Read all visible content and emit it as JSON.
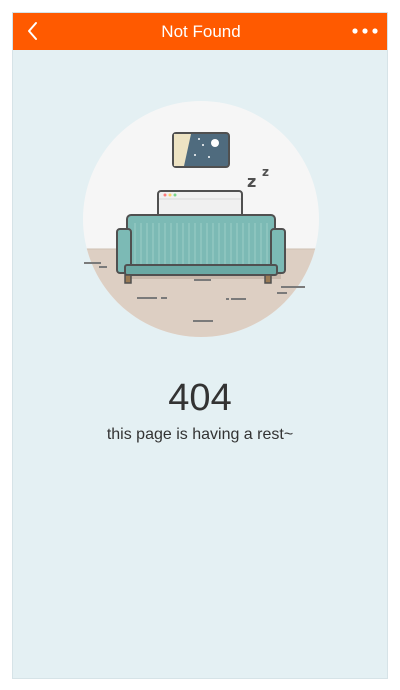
{
  "navbar": {
    "title": "Not Found",
    "back_icon": "chevron-left-icon",
    "more_icon": "more-dots-icon",
    "color": "#ff5a00"
  },
  "error": {
    "code": "404",
    "message": "this page is having a rest~"
  },
  "illustration": {
    "subject": "sofa-sleeping-scene",
    "sleep_text": "z z"
  },
  "colors": {
    "background": "#e4f0f3",
    "sofa": "#7cbab5",
    "floor": "#ddcfc3"
  }
}
